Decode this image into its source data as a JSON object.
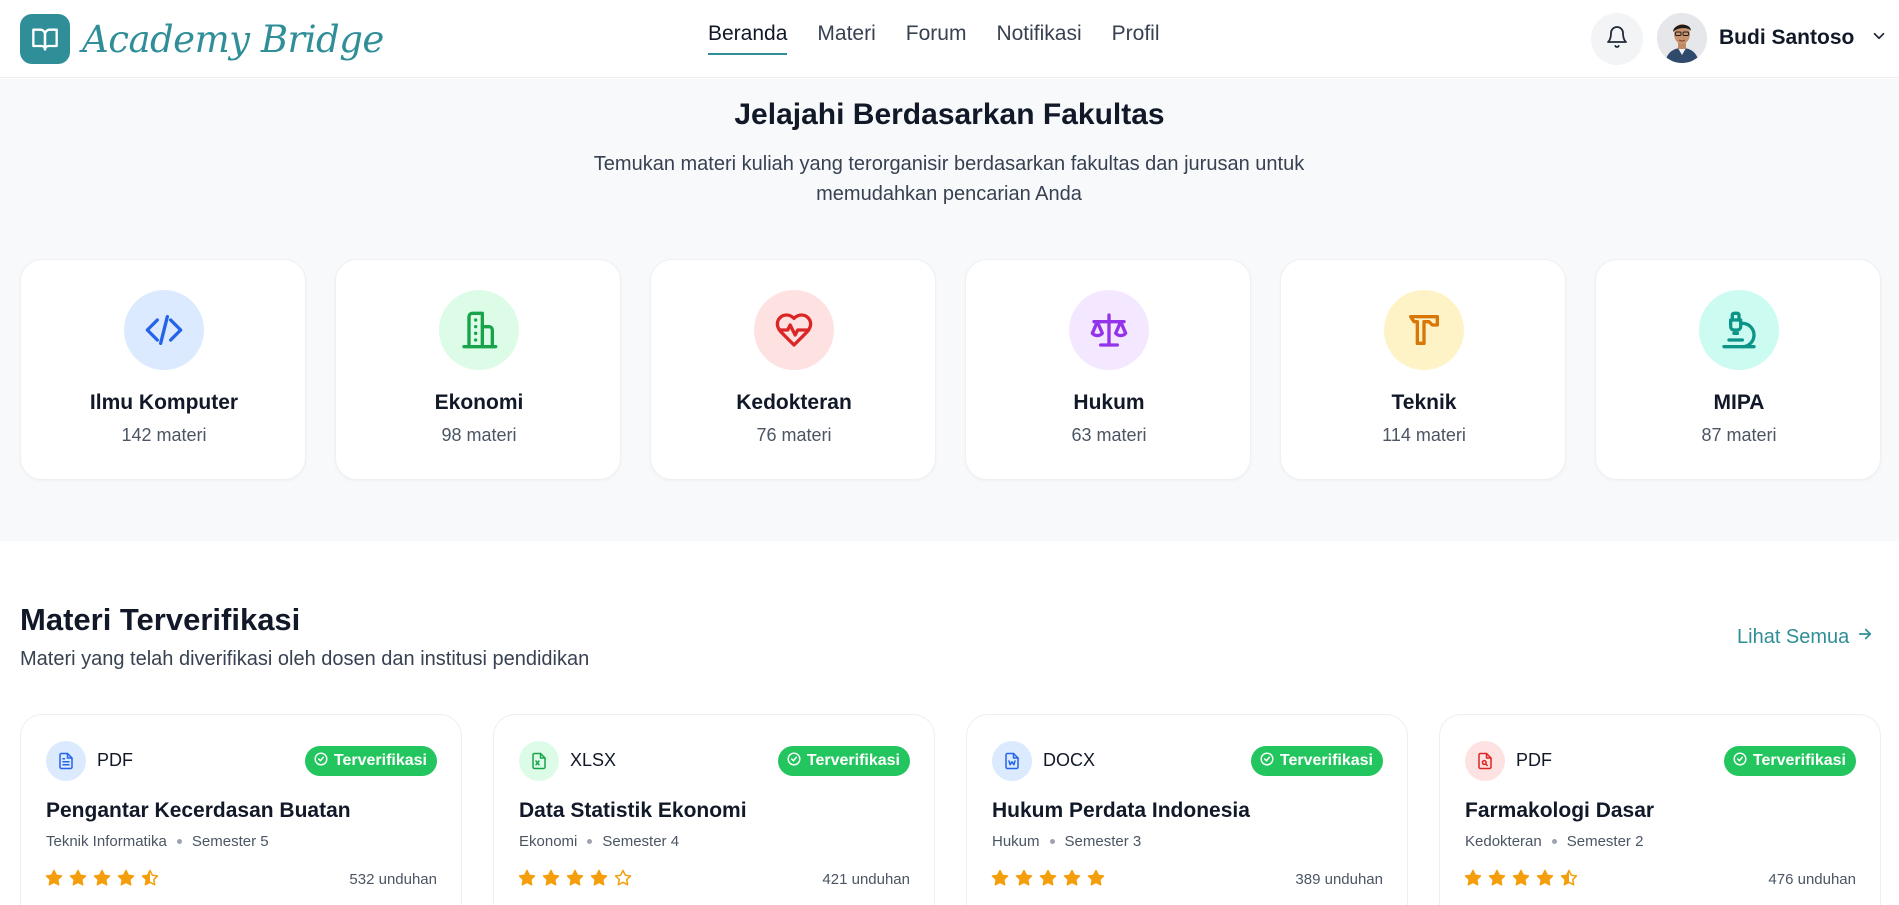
{
  "brand": {
    "name": "Academy Bridge",
    "color": "#2f8e97"
  },
  "nav": {
    "items": [
      {
        "label": "Beranda",
        "active": true
      },
      {
        "label": "Materi",
        "active": false
      },
      {
        "label": "Forum",
        "active": false
      },
      {
        "label": "Notifikasi",
        "active": false
      },
      {
        "label": "Profil",
        "active": false
      }
    ]
  },
  "user": {
    "name": "Budi Santoso",
    "icons": [
      "bell-icon",
      "avatar",
      "chevron-down-icon"
    ]
  },
  "faculties": {
    "title": "Jelajahi Berdasarkan Fakultas",
    "subtitle_line1": "Temukan materi kuliah yang terorganisir berdasarkan fakultas dan jurusan untuk",
    "subtitle_line2": "memudahkan pencarian Anda",
    "items": [
      {
        "name": "Ilmu Komputer",
        "count": "142 materi",
        "icon": "code-icon",
        "bg": "#dbeafe",
        "color": "#2563eb"
      },
      {
        "name": "Ekonomi",
        "count": "98 materi",
        "icon": "building-icon",
        "bg": "#dcfce7",
        "color": "#16a34a"
      },
      {
        "name": "Kedokteran",
        "count": "76 materi",
        "icon": "heart-pulse-icon",
        "bg": "#fee2e2",
        "color": "#dc2626"
      },
      {
        "name": "Hukum",
        "count": "63 materi",
        "icon": "scale-icon",
        "bg": "#f3e8ff",
        "color": "#9333ea"
      },
      {
        "name": "Teknik",
        "count": "114 materi",
        "icon": "hammer-icon",
        "bg": "#fef3c7",
        "color": "#d97706"
      },
      {
        "name": "MIPA",
        "count": "87 materi",
        "icon": "microscope-icon",
        "bg": "#ccfbf1",
        "color": "#0d9488"
      }
    ]
  },
  "verified": {
    "title": "Materi Terverifikasi",
    "subtitle": "Materi yang telah diverifikasi oleh dosen dan institusi pendidikan",
    "see_all": "Lihat Semua",
    "badge_label": "Terverifikasi",
    "badge_color": "#22c55e",
    "star_color": "#f59e0b",
    "items": [
      {
        "type": "PDF",
        "icon": "file-text-icon",
        "icon_bg": "#dbeafe",
        "icon_color": "#2563eb",
        "title": "Pengantar Kecerdasan Buatan",
        "department": "Teknik Informatika",
        "semester": "Semester 5",
        "rating": 4.5,
        "downloads": "532 unduhan"
      },
      {
        "type": "XLSX",
        "icon": "spreadsheet-icon",
        "icon_bg": "#dcfce7",
        "icon_color": "#16a34a",
        "title": "Data Statistik Ekonomi",
        "department": "Ekonomi",
        "semester": "Semester 4",
        "rating": 4,
        "downloads": "421 unduhan"
      },
      {
        "type": "DOCX",
        "icon": "document-icon",
        "icon_bg": "#dbeafe",
        "icon_color": "#2563eb",
        "title": "Hukum Perdata Indonesia",
        "department": "Hukum",
        "semester": "Semester 3",
        "rating": 5,
        "downloads": "389 unduhan"
      },
      {
        "type": "PDF",
        "icon": "pdf-file-icon",
        "icon_bg": "#fee2e2",
        "icon_color": "#dc2626",
        "title": "Farmakologi Dasar",
        "department": "Kedokteran",
        "semester": "Semester 2",
        "rating": 4.5,
        "downloads": "476 unduhan"
      }
    ]
  }
}
